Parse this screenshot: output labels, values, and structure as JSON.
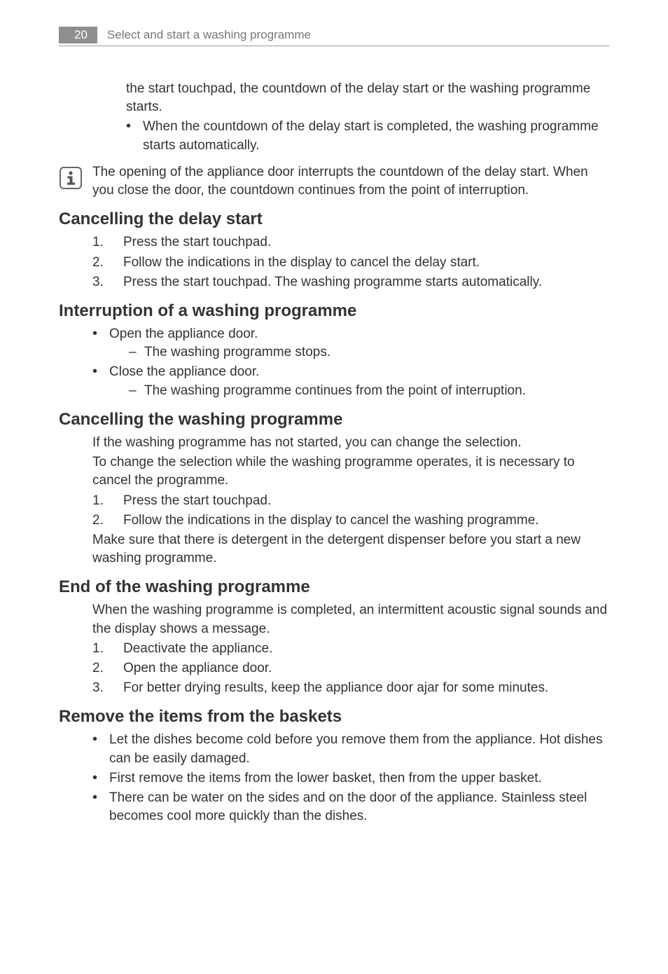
{
  "header": {
    "page_number": "20",
    "title": "Select and start a washing programme"
  },
  "intro": {
    "continuation": "the start touchpad, the countdown of the delay start or the washing programme starts.",
    "bullet1": "When the countdown of the delay start is completed, the washing programme starts automatically."
  },
  "info_note": "The opening of the appliance door interrupts the countdown of the delay start. When you close the door, the countdown continues from the point of interruption.",
  "sections": {
    "cancel_delay": {
      "heading": "Cancelling the delay start",
      "steps": [
        "Press the start touchpad.",
        "Follow the indications in the display to cancel the delay start.",
        "Press the start touchpad. The washing programme starts automatically."
      ]
    },
    "interruption": {
      "heading": "Interruption of a washing programme",
      "bullets": [
        {
          "text": "Open the appliance door.",
          "sub": "The washing programme stops."
        },
        {
          "text": "Close the appliance door.",
          "sub": "The washing programme continues from the point of interruption."
        }
      ]
    },
    "cancel_wash": {
      "heading": "Cancelling the washing programme",
      "intro1": "If the washing programme has not started, you can change the selection.",
      "intro2": "To change the selection while the washing programme operates, it is necessary to cancel the programme.",
      "steps": [
        "Press the start touchpad.",
        "Follow the indications in the display to cancel the washing programme."
      ],
      "outro": "Make sure that there is detergent in the detergent dispenser before you start a new washing programme."
    },
    "end": {
      "heading": "End of the washing programme",
      "intro": "When the washing programme is completed, an intermittent acoustic signal sounds and the display shows a message.",
      "steps": [
        "Deactivate the appliance.",
        "Open the appliance door.",
        "For better drying results, keep the appliance door ajar for some minutes."
      ]
    },
    "remove": {
      "heading": "Remove the items from the baskets",
      "bullets": [
        "Let the dishes become cold before you remove them from the appliance. Hot dishes can be easily damaged.",
        "First remove the items from the lower basket, then from the upper basket.",
        "There can be water on the sides and on the door of the appliance. Stainless steel becomes cool more quickly than the dishes."
      ]
    }
  }
}
